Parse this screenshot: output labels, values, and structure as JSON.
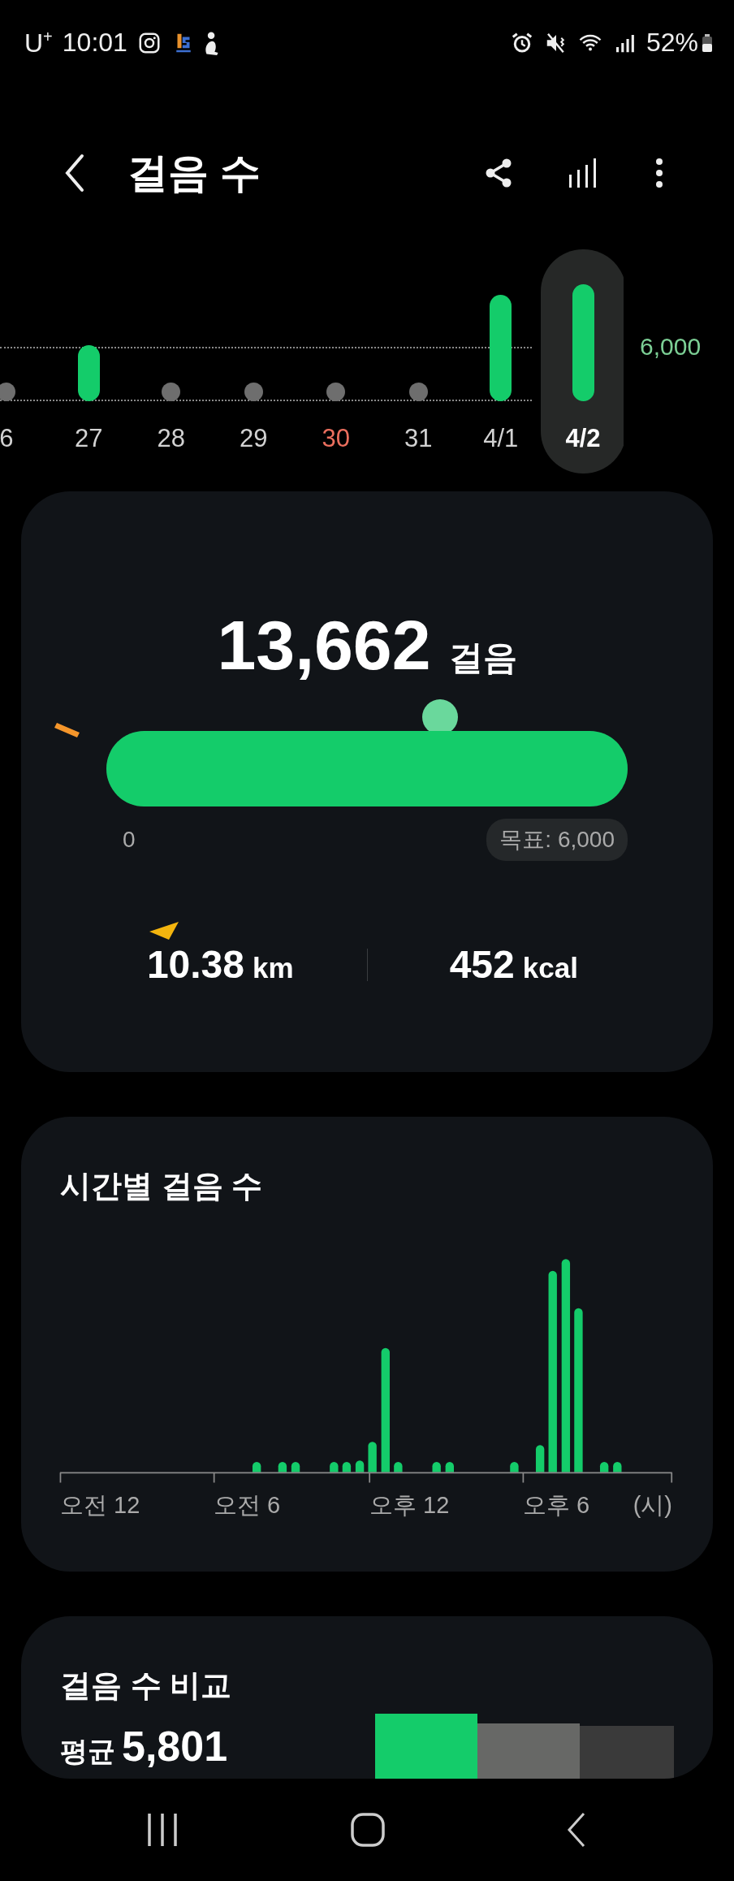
{
  "status_bar": {
    "carrier": "U$^{+}$",
    "time": "10:01",
    "battery": "52%"
  },
  "header": {
    "title": "걸음 수"
  },
  "days": [
    {
      "label": "6",
      "kind": "dot",
      "selected": false,
      "color": "#d2d2d2"
    },
    {
      "label": "27",
      "kind": "low_bar",
      "selected": false,
      "color": "#d2d2d2"
    },
    {
      "label": "28",
      "kind": "dot",
      "selected": false,
      "color": "#d2d2d2"
    },
    {
      "label": "29",
      "kind": "dot",
      "selected": false,
      "color": "#d2d2d2"
    },
    {
      "label": "30",
      "kind": "dot",
      "selected": false,
      "color": "#ec6f5e"
    },
    {
      "label": "31",
      "kind": "dot",
      "selected": false,
      "color": "#d2d2d2"
    },
    {
      "label": "4/1",
      "kind": "high_bar",
      "selected": false,
      "color": "#d2d2d2"
    },
    {
      "label": "4/2",
      "kind": "top_bar",
      "selected": true,
      "color": "#ffffff"
    }
  ],
  "goal_line_label": "6,000",
  "summary": {
    "steps": "13,662",
    "steps_unit": "걸음",
    "progress": {
      "level": 1,
      "marker": {
        "level": 0.64
      }
    },
    "scale_start": "0",
    "goal": "목표: 6,000",
    "distance": "10.38",
    "distance_unit": "km",
    "calories": "452",
    "calories_unit": "kcal"
  },
  "hourly": {
    "title": "시간별 걸음 수",
    "x_labels": [
      "오전 12",
      "오전 6",
      "오후 12",
      "오후 6"
    ],
    "unit": "(시)"
  },
  "comparison": {
    "title": "걸음 수 비교",
    "average_label": "평균",
    "average": "5,801"
  }
}
